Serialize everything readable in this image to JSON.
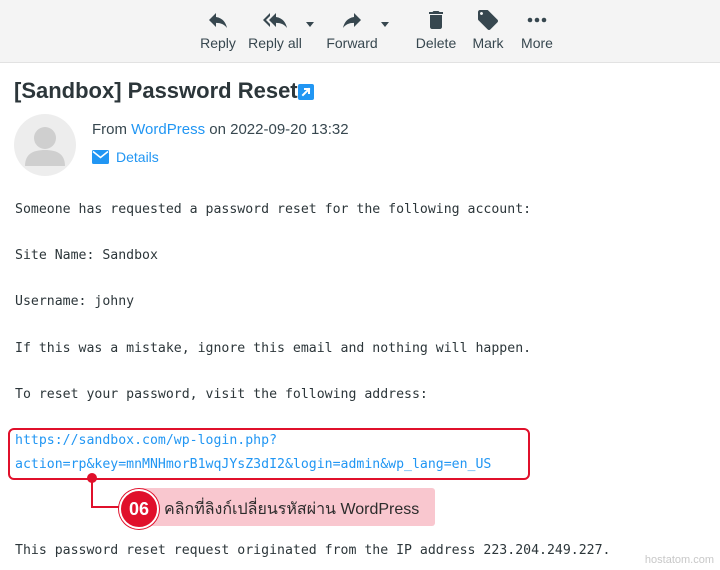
{
  "toolbar": {
    "reply": {
      "label": "Reply",
      "icon": "reply-icon"
    },
    "reply_all": {
      "label": "Reply all",
      "icon": "reply-all-icon"
    },
    "forward": {
      "label": "Forward",
      "icon": "forward-icon"
    },
    "delete": {
      "label": "Delete",
      "icon": "trash-icon"
    },
    "mark": {
      "label": "Mark",
      "icon": "tag-icon"
    },
    "more": {
      "label": "More",
      "icon": "more-dots-icon"
    }
  },
  "message": {
    "subject": "[Sandbox] Password Reset",
    "from_prefix": "From",
    "sender": "WordPress",
    "date_text": "on 2022-09-20 13:32",
    "details_label": "Details"
  },
  "body": {
    "line1": "Someone has requested a password reset for the following account:",
    "line2": "Site Name: Sandbox",
    "line3": "Username: johny",
    "line4": "If this was a mistake, ignore this email and nothing will happen.",
    "line5": "To reset your password, visit the following address:",
    "url_line1": "https://sandbox.com/wp-login.php?",
    "url_line2": "action=rp&key=mnMNHmorB1wqJYsZ3dI2&login=admin&wp_lang=en_US",
    "line6": "This password reset request originated from the IP address 223.204.249.227."
  },
  "annotation": {
    "step": "06",
    "text": "คลิกที่ลิงก์เปลี่ยนรหัสผ่าน WordPress"
  },
  "watermark": "hostatom.com",
  "colors": {
    "accent": "#2196f3",
    "highlight": "#e0102b",
    "callout_bg": "#f9c7cf",
    "toolbar_bg": "#f4f4f4"
  }
}
